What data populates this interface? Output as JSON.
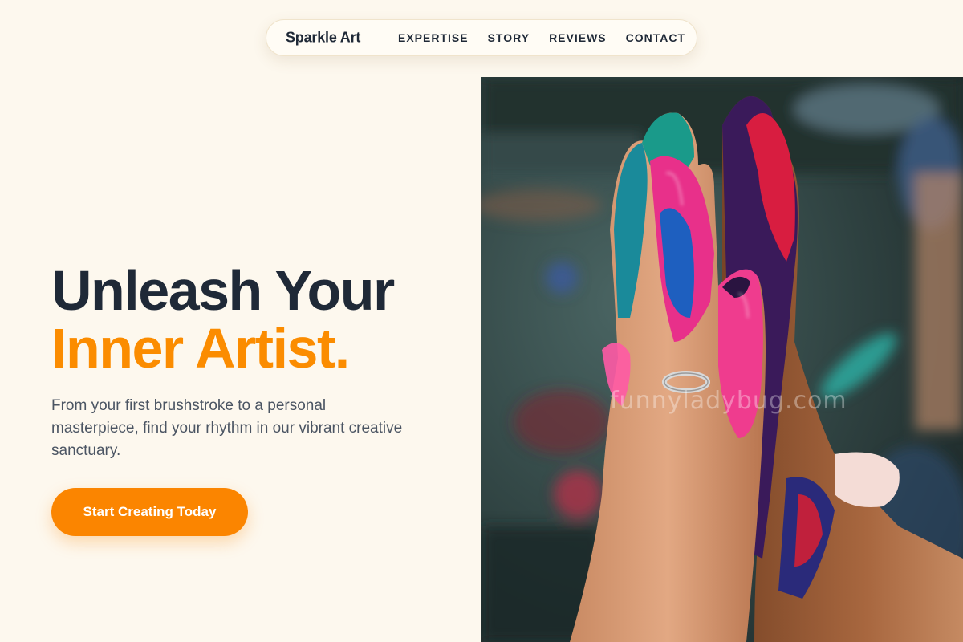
{
  "nav": {
    "brand": "Sparkle Art",
    "links": [
      {
        "label": "EXPERTISE"
      },
      {
        "label": "STORY"
      },
      {
        "label": "REVIEWS"
      },
      {
        "label": "CONTACT"
      }
    ]
  },
  "hero": {
    "title_line1": "Unleash Your",
    "title_line2": "Inner Artist.",
    "subtitle": "From your first brushstroke to a personal masterpiece, find your rhythm in our vibrant creative sanctuary.",
    "cta_label": "Start Creating Today"
  },
  "photo": {
    "watermark": "funnyladybug.com",
    "icon": "painted-hands-image"
  },
  "colors": {
    "background": "#fdf8ee",
    "accent": "#fb8c00",
    "heading": "#1f2937",
    "body_text": "#4b5563"
  }
}
